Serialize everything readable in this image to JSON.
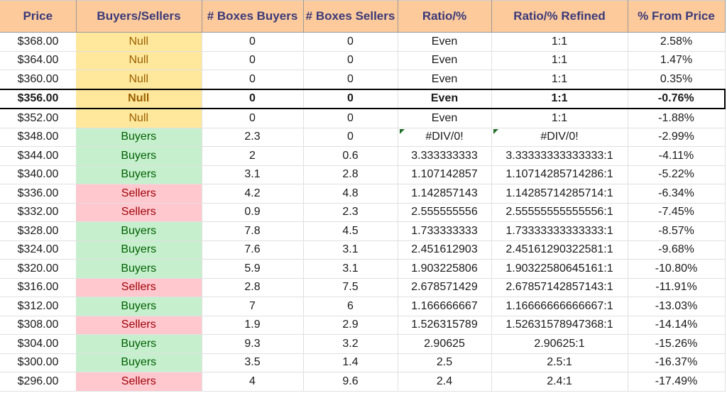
{
  "columns": [
    "Price",
    "Buyers/Sellers",
    "# Boxes Buyers",
    "# Boxes Sellers",
    "Ratio/%",
    "Ratio/% Refined",
    "% From Price"
  ],
  "current_price_row_index": 3,
  "colors": {
    "header_bg": "#fdca9c",
    "header_text": "#3a3a7a",
    "null_bg": "#ffe89c",
    "null_text": "#9a5f00",
    "buyers_bg": "#c6efce",
    "buyers_text": "#006100",
    "sellers_bg": "#ffc7ce",
    "sellers_text": "#9c0006",
    "error_indicator": "#1f6e2a"
  },
  "rows": [
    {
      "price": "$368.00",
      "side": "Null",
      "boxes_buyers": "0",
      "boxes_sellers": "0",
      "ratio": "Even",
      "ratio_refined": "1:1",
      "pct_from_price": "2.58%",
      "error": false
    },
    {
      "price": "$364.00",
      "side": "Null",
      "boxes_buyers": "0",
      "boxes_sellers": "0",
      "ratio": "Even",
      "ratio_refined": "1:1",
      "pct_from_price": "1.47%",
      "error": false
    },
    {
      "price": "$360.00",
      "side": "Null",
      "boxes_buyers": "0",
      "boxes_sellers": "0",
      "ratio": "Even",
      "ratio_refined": "1:1",
      "pct_from_price": "0.35%",
      "error": false
    },
    {
      "price": "$356.00",
      "side": "Null",
      "boxes_buyers": "0",
      "boxes_sellers": "0",
      "ratio": "Even",
      "ratio_refined": "1:1",
      "pct_from_price": "-0.76%",
      "error": false
    },
    {
      "price": "$352.00",
      "side": "Null",
      "boxes_buyers": "0",
      "boxes_sellers": "0",
      "ratio": "Even",
      "ratio_refined": "1:1",
      "pct_from_price": "-1.88%",
      "error": false
    },
    {
      "price": "$348.00",
      "side": "Buyers",
      "boxes_buyers": "2.3",
      "boxes_sellers": "0",
      "ratio": "#DIV/0!",
      "ratio_refined": "#DIV/0!",
      "pct_from_price": "-2.99%",
      "error": true
    },
    {
      "price": "$344.00",
      "side": "Buyers",
      "boxes_buyers": "2",
      "boxes_sellers": "0.6",
      "ratio": "3.333333333",
      "ratio_refined": "3.33333333333333:1",
      "pct_from_price": "-4.11%",
      "error": false
    },
    {
      "price": "$340.00",
      "side": "Buyers",
      "boxes_buyers": "3.1",
      "boxes_sellers": "2.8",
      "ratio": "1.107142857",
      "ratio_refined": "1.10714285714286:1",
      "pct_from_price": "-5.22%",
      "error": false
    },
    {
      "price": "$336.00",
      "side": "Sellers",
      "boxes_buyers": "4.2",
      "boxes_sellers": "4.8",
      "ratio": "1.142857143",
      "ratio_refined": "1.14285714285714:1",
      "pct_from_price": "-6.34%",
      "error": false
    },
    {
      "price": "$332.00",
      "side": "Sellers",
      "boxes_buyers": "0.9",
      "boxes_sellers": "2.3",
      "ratio": "2.555555556",
      "ratio_refined": "2.55555555555556:1",
      "pct_from_price": "-7.45%",
      "error": false
    },
    {
      "price": "$328.00",
      "side": "Buyers",
      "boxes_buyers": "7.8",
      "boxes_sellers": "4.5",
      "ratio": "1.733333333",
      "ratio_refined": "1.73333333333333:1",
      "pct_from_price": "-8.57%",
      "error": false
    },
    {
      "price": "$324.00",
      "side": "Buyers",
      "boxes_buyers": "7.6",
      "boxes_sellers": "3.1",
      "ratio": "2.451612903",
      "ratio_refined": "2.45161290322581:1",
      "pct_from_price": "-9.68%",
      "error": false
    },
    {
      "price": "$320.00",
      "side": "Buyers",
      "boxes_buyers": "5.9",
      "boxes_sellers": "3.1",
      "ratio": "1.903225806",
      "ratio_refined": "1.90322580645161:1",
      "pct_from_price": "-10.80%",
      "error": false
    },
    {
      "price": "$316.00",
      "side": "Sellers",
      "boxes_buyers": "2.8",
      "boxes_sellers": "7.5",
      "ratio": "2.678571429",
      "ratio_refined": "2.67857142857143:1",
      "pct_from_price": "-11.91%",
      "error": false
    },
    {
      "price": "$312.00",
      "side": "Buyers",
      "boxes_buyers": "7",
      "boxes_sellers": "6",
      "ratio": "1.166666667",
      "ratio_refined": "1.16666666666667:1",
      "pct_from_price": "-13.03%",
      "error": false
    },
    {
      "price": "$308.00",
      "side": "Sellers",
      "boxes_buyers": "1.9",
      "boxes_sellers": "2.9",
      "ratio": "1.526315789",
      "ratio_refined": "1.52631578947368:1",
      "pct_from_price": "-14.14%",
      "error": false
    },
    {
      "price": "$304.00",
      "side": "Buyers",
      "boxes_buyers": "9.3",
      "boxes_sellers": "3.2",
      "ratio": "2.90625",
      "ratio_refined": "2.90625:1",
      "pct_from_price": "-15.26%",
      "error": false
    },
    {
      "price": "$300.00",
      "side": "Buyers",
      "boxes_buyers": "3.5",
      "boxes_sellers": "1.4",
      "ratio": "2.5",
      "ratio_refined": "2.5:1",
      "pct_from_price": "-16.37%",
      "error": false
    },
    {
      "price": "$296.00",
      "side": "Sellers",
      "boxes_buyers": "4",
      "boxes_sellers": "9.6",
      "ratio": "2.4",
      "ratio_refined": "2.4:1",
      "pct_from_price": "-17.49%",
      "error": false
    }
  ]
}
